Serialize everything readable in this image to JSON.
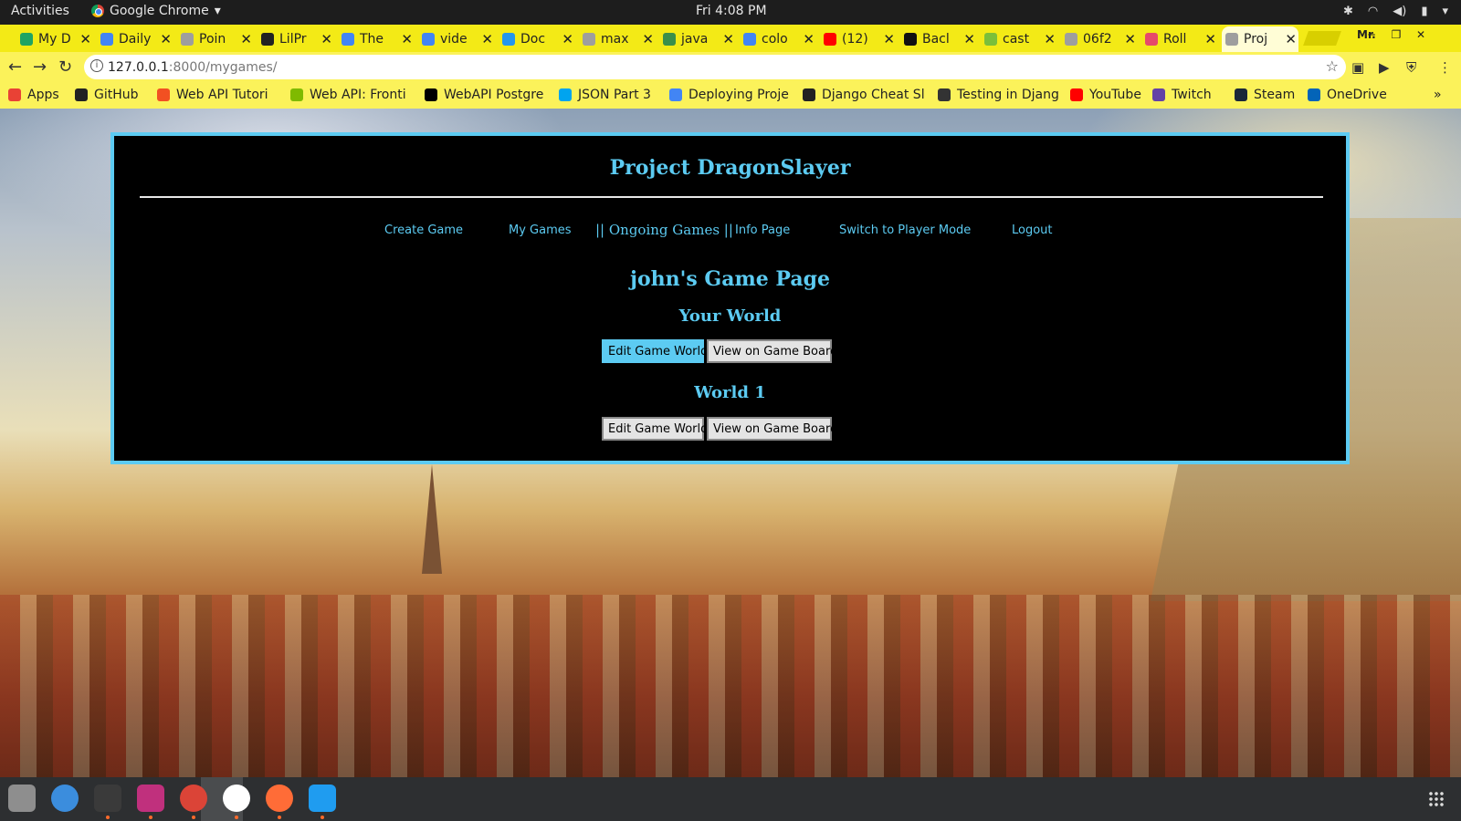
{
  "system_bar": {
    "activities": "Activities",
    "app_name": "Google Chrome",
    "clock": "Fri  4:08 PM",
    "tray_icons": [
      "slack-tray-icon",
      "wifi-icon",
      "volume-icon",
      "battery-icon",
      "power-menu-icon"
    ]
  },
  "tabs": [
    {
      "label": "My D",
      "icon": "google-drive-icon",
      "color": "#1fa463"
    },
    {
      "label": "Daily",
      "icon": "google-docs-icon",
      "color": "#4285f4"
    },
    {
      "label": "Poin",
      "icon": "file-icon",
      "color": "#9e9e9e"
    },
    {
      "label": "LilPr",
      "icon": "github-icon",
      "color": "#222222"
    },
    {
      "label": "The",
      "icon": "google-icon",
      "color": "#4285f4"
    },
    {
      "label": "vide",
      "icon": "google-icon",
      "color": "#4285f4"
    },
    {
      "label": "Doc",
      "icon": "docker-icon",
      "color": "#2496ed"
    },
    {
      "label": "max",
      "icon": "file-icon",
      "color": "#9e9e9e"
    },
    {
      "label": "java",
      "icon": "cloud-icon",
      "color": "#3a8f4a"
    },
    {
      "label": "colo",
      "icon": "google-icon",
      "color": "#4285f4"
    },
    {
      "label": "(12)",
      "icon": "youtube-icon",
      "color": "#ff0000"
    },
    {
      "label": "Bacl",
      "icon": "bootstrap-icon",
      "color": "#111111"
    },
    {
      "label": "cast",
      "icon": "castle-icon",
      "color": "#7bbf3a"
    },
    {
      "label": "06f2",
      "icon": "file-icon",
      "color": "#9e9e9e"
    },
    {
      "label": "Roll",
      "icon": "dice-icon",
      "color": "#e64a6a"
    },
    {
      "label": "Proj",
      "icon": "file-icon",
      "color": "#9e9e9e",
      "active": true
    }
  ],
  "profile_label": "Mr.",
  "address_bar": {
    "host": "127.0.0.1",
    "path": ":8000/mygames/"
  },
  "bookmarks": [
    {
      "label": "Apps",
      "icon": "apps-grid-icon",
      "color": "#e94235"
    },
    {
      "label": "GitHub",
      "icon": "github-icon",
      "color": "#222222"
    },
    {
      "label": "Web API Tutori",
      "icon": "microsoft-icon",
      "color": "#f25022"
    },
    {
      "label": "Web API: Fronti",
      "icon": "microsoft-icon",
      "color": "#7fba00"
    },
    {
      "label": "WebAPI Postgre",
      "icon": "medium-icon",
      "color": "#000000"
    },
    {
      "label": "JSON Part 3",
      "icon": "microsoft-icon",
      "color": "#00a4ef"
    },
    {
      "label": "Deploying Proje",
      "icon": "google-docs-icon",
      "color": "#4285f4"
    },
    {
      "label": "Django Cheat Sl",
      "icon": "github-icon",
      "color": "#222222"
    },
    {
      "label": "Testing in Djang",
      "icon": "globe-icon",
      "color": "#333333"
    },
    {
      "label": "YouTube",
      "icon": "youtube-icon",
      "color": "#ff0000"
    },
    {
      "label": "Twitch",
      "icon": "twitch-icon",
      "color": "#6441a5"
    },
    {
      "label": "Steam",
      "icon": "steam-icon",
      "color": "#1b2838"
    },
    {
      "label": "OneDrive",
      "icon": "onedrive-icon",
      "color": "#0364b8"
    }
  ],
  "site": {
    "title": "Project DragonSlayer",
    "nav": [
      {
        "label": "Create Game"
      },
      {
        "label": "My Games"
      },
      {
        "label": "|| Ongoing Games ||",
        "current": true
      },
      {
        "label": "Info Page"
      },
      {
        "label": "Switch to Player Mode"
      },
      {
        "label": "Logout"
      }
    ],
    "page_heading": "john's Game Page",
    "worlds": [
      {
        "name": "Your World",
        "edit_label": "Edit Game World",
        "view_label": "View on Game Board",
        "edit_highlighted": true
      },
      {
        "name": "World 1",
        "edit_label": "Edit Game World",
        "view_label": "View on Game Board",
        "edit_highlighted": false
      }
    ]
  },
  "dock_apps": [
    {
      "icon": "files-icon",
      "color": "#8e8e8e"
    },
    {
      "icon": "help-icon",
      "color": "#3b8ddd"
    },
    {
      "icon": "terminal-icon",
      "color": "#3a3a3a"
    },
    {
      "icon": "intellij-icon",
      "color": "#c0307d"
    },
    {
      "icon": "chrome-icon",
      "color": "#db4437"
    },
    {
      "icon": "slack-icon",
      "color": "#ffffff"
    },
    {
      "icon": "postman-icon",
      "color": "#ff6c37"
    },
    {
      "icon": "vscode-icon",
      "color": "#1f9cf0"
    }
  ],
  "colors": {
    "accent": "#5ccbf2",
    "tabstrip": "#f3ea16",
    "panel_bg": "#000000"
  }
}
